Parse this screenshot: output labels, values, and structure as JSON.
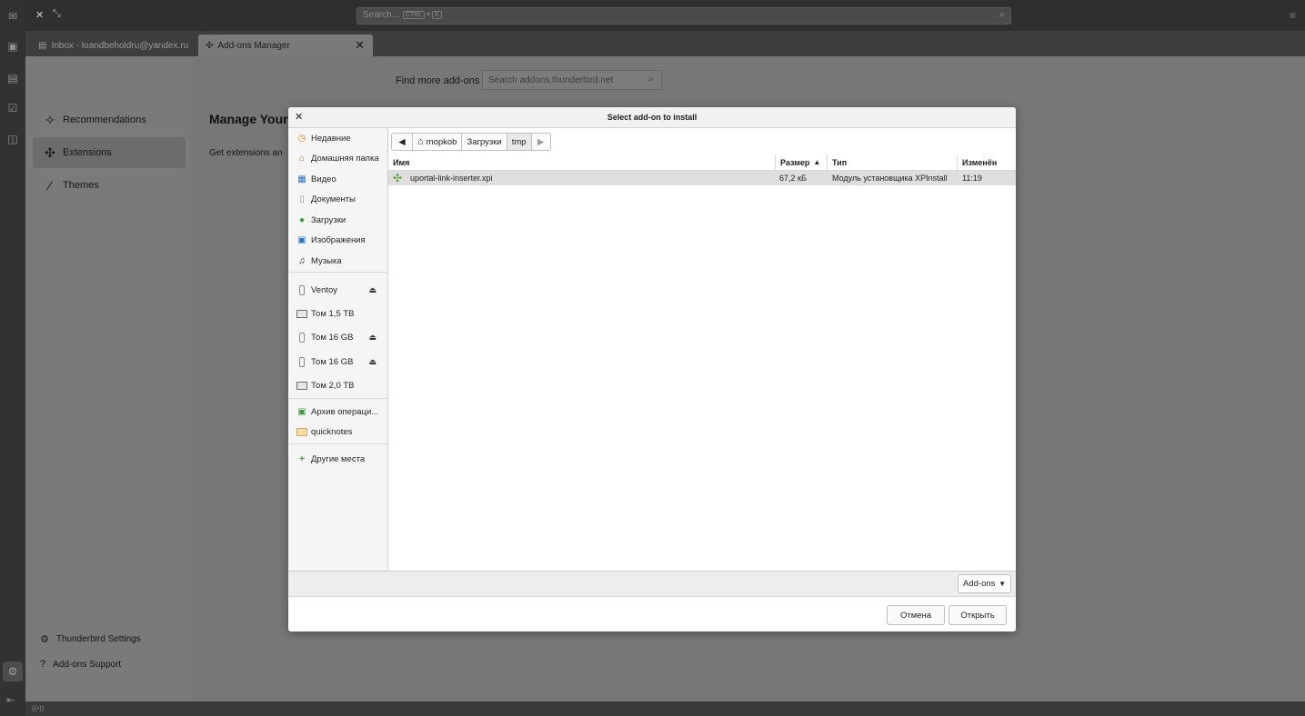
{
  "window": {
    "search_placeholder": "Search...",
    "search_shortcut_key1": "CTRL",
    "search_shortcut_plus": "+",
    "search_shortcut_key2": "K"
  },
  "tabs": [
    {
      "label": "Inbox - loandbeholdru@yandex.ru"
    },
    {
      "label": "Add-ons Manager"
    }
  ],
  "addons_manager": {
    "find_more_label": "Find more add-ons",
    "search_placeholder": "Search addons.thunderbird.net",
    "categories": [
      {
        "label": "Recommendations"
      },
      {
        "label": "Extensions"
      },
      {
        "label": "Themes"
      }
    ],
    "manage_title": "Manage Your",
    "get_extensions_text": "Get extensions an",
    "footer_links": [
      {
        "label": "Thunderbird Settings"
      },
      {
        "label": "Add-ons Support"
      }
    ]
  },
  "status_bar": {
    "text": "((•))"
  },
  "dialog": {
    "title": "Select add-on to install",
    "places": [
      {
        "label": "Недавние"
      },
      {
        "label": "Домашняя папка"
      },
      {
        "label": "Видео"
      },
      {
        "label": "Документы"
      },
      {
        "label": "Загрузки"
      },
      {
        "label": "Изображения"
      },
      {
        "label": "Музыка"
      }
    ],
    "devices": [
      {
        "label": "Ventoy"
      },
      {
        "label": "Том 1,5 TB"
      },
      {
        "label": "Том 16 GB"
      },
      {
        "label": "Том 16 GB"
      },
      {
        "label": "Том 2,0 TB"
      }
    ],
    "bookmarks": [
      {
        "label": "Архив операци..."
      },
      {
        "label": "quicknotes"
      }
    ],
    "other_places": "Другие места",
    "path": [
      "mopkob",
      "Загрузки",
      "tmp"
    ],
    "columns": {
      "name": "Имя",
      "size": "Размер",
      "type": "Тип",
      "modified": "Изменён"
    },
    "files": [
      {
        "name": "uportal-link-inserter.xpi",
        "size": "67,2 кБ",
        "type": "Модуль установщика XPInstall",
        "modified": "11:19"
      }
    ],
    "filter": "Add-ons",
    "cancel_label": "Отмена",
    "open_label": "Открыть"
  }
}
